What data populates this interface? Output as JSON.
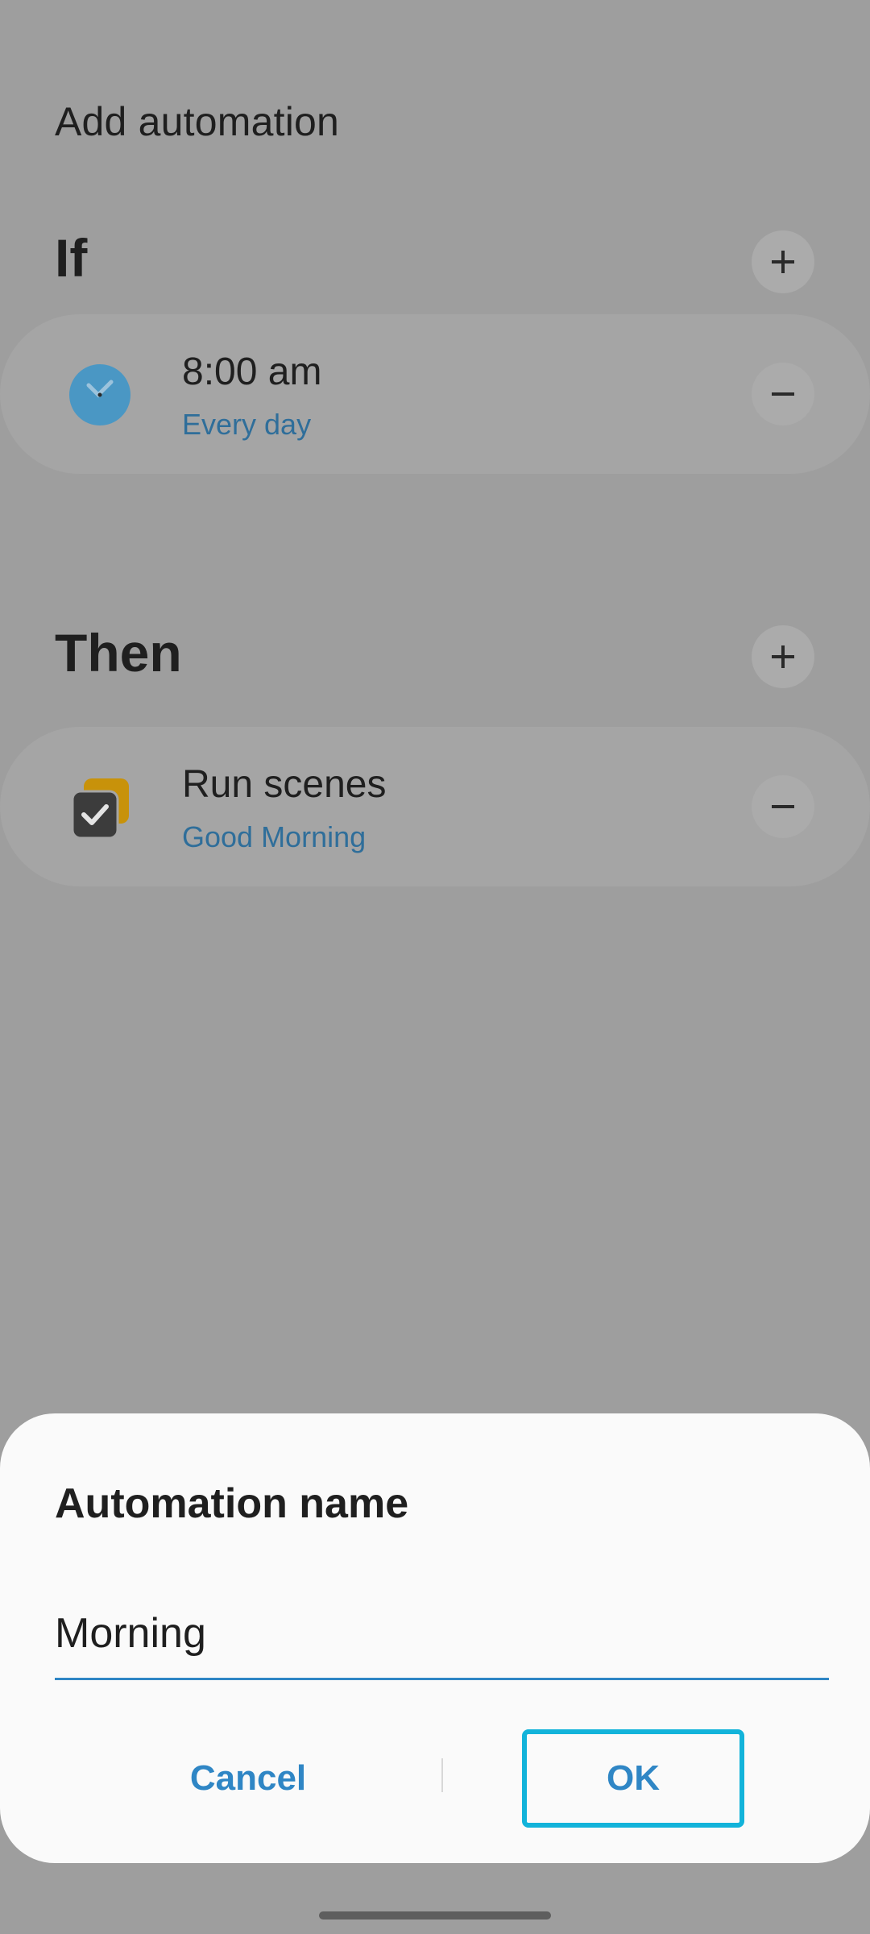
{
  "header": {
    "title": "Add automation"
  },
  "if_section": {
    "title": "If",
    "card": {
      "title": "8:00 am",
      "subtitle": "Every day",
      "icon": "clock-icon"
    }
  },
  "then_section": {
    "title": "Then",
    "card": {
      "title": "Run scenes",
      "subtitle": "Good Morning",
      "icon": "scenes-icon"
    }
  },
  "dialog": {
    "title": "Automation name",
    "input_value": "Morning",
    "cancel_label": "Cancel",
    "ok_label": "OK"
  },
  "colors": {
    "accent": "#2f86c5",
    "highlight_border": "#12b3da",
    "scrim_background": "#9e9e9e",
    "dialog_background": "#fafafa",
    "clock_icon": "#4a97c4",
    "scenes_icon_back": "#c8920a"
  }
}
